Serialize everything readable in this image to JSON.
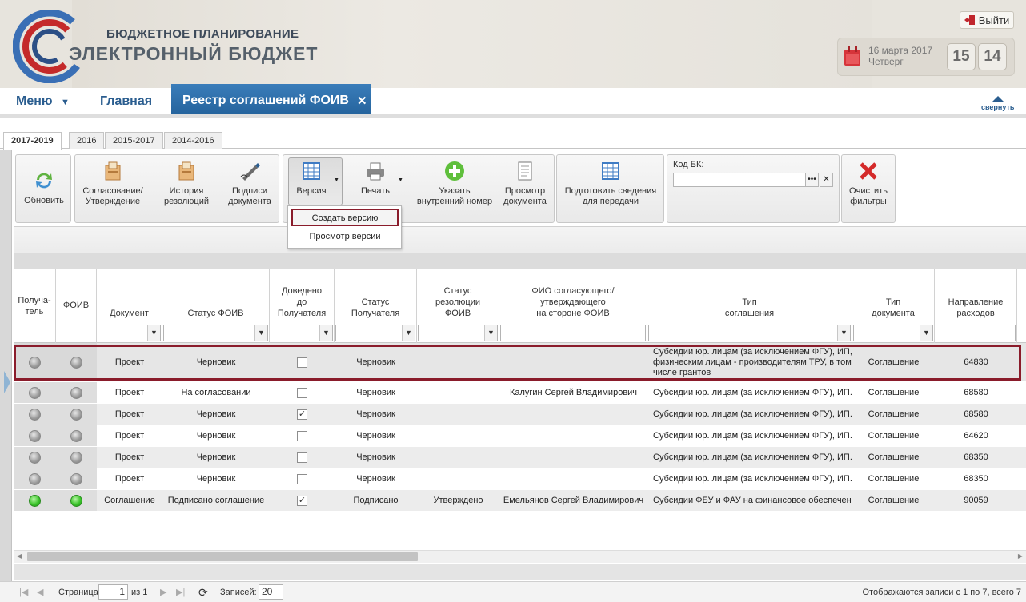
{
  "header": {
    "brand_line1": "БЮДЖЕТНОЕ ПЛАНИРОВАНИЕ",
    "brand_line2": "ЭЛЕКТРОННЫЙ БЮДЖЕТ",
    "exit_label": "Выйти",
    "date": "16 марта 2017",
    "weekday": "Четверг",
    "clock_hours": "15",
    "clock_minutes": "14"
  },
  "nav": {
    "menu_label": "Меню",
    "home_label": "Главная",
    "active_tab": "Реестр соглашений ФОИВ",
    "collapse_label": "свернуть"
  },
  "year_tabs": [
    "2017-2019",
    "2016",
    "2015-2017",
    "2014-2016"
  ],
  "toolbar": {
    "refresh": "Обновить",
    "approval": [
      "Согласование/",
      "Утверждение"
    ],
    "history": [
      "История",
      "резолюций"
    ],
    "signatures": [
      "Подписи",
      "документа"
    ],
    "version": "Версия",
    "print": "Печать",
    "internal_number": [
      "Указать",
      "внутренний номер"
    ],
    "view_document": [
      "Просмотр",
      "документа"
    ],
    "prepare_data": [
      "Подготовить сведения",
      "для передачи"
    ],
    "kbk_label": "Код БК:",
    "kbk_value": "",
    "clear_filters": [
      "Очистить",
      "фильтры"
    ]
  },
  "version_menu": {
    "create": "Создать версию",
    "view": "Просмотр версии"
  },
  "columns": [
    [
      "Получа-",
      "тель"
    ],
    [
      "ФОИВ"
    ],
    [
      "Документ"
    ],
    [
      "Статус ФОИВ"
    ],
    [
      "Доведено",
      "до",
      "Получателя"
    ],
    [
      "Статус",
      "Получателя"
    ],
    [
      "Статус",
      "резолюции",
      "ФОИВ"
    ],
    [
      "ФИО согласующего/",
      "утверждающего",
      "на стороне ФОИВ"
    ],
    [
      "Тип",
      "соглашения"
    ],
    [
      "Тип",
      "документа"
    ],
    [
      "Направление",
      "расходов"
    ]
  ],
  "rows": [
    {
      "recipient_lamp": "grey",
      "foiv_lamp": "grey",
      "document": "Проект",
      "foiv_status": "Черновик",
      "delivered": false,
      "recipient_status": "Черновик",
      "resolution_status": "",
      "approver": "",
      "agreement_type": "Субсидии юр. лицам (за исключением ФГУ), ИП, физическим лицам - производителям ТРУ, в том числе грантов",
      "doc_type": "Соглашение",
      "expense_direction": "64830"
    },
    {
      "recipient_lamp": "grey",
      "foiv_lamp": "grey",
      "document": "Проект",
      "foiv_status": "На согласовании",
      "delivered": false,
      "recipient_status": "Черновик",
      "resolution_status": "",
      "approver": "Калугин Сергей Владимирович",
      "agreement_type": "Субсидии юр. лицам (за исключением ФГУ), ИП...",
      "doc_type": "Соглашение",
      "expense_direction": "68580"
    },
    {
      "recipient_lamp": "grey",
      "foiv_lamp": "grey",
      "document": "Проект",
      "foiv_status": "Черновик",
      "delivered": true,
      "recipient_status": "Черновик",
      "resolution_status": "",
      "approver": "",
      "agreement_type": "Субсидии юр. лицам (за исключением ФГУ), ИП...",
      "doc_type": "Соглашение",
      "expense_direction": "68580"
    },
    {
      "recipient_lamp": "grey",
      "foiv_lamp": "grey",
      "document": "Проект",
      "foiv_status": "Черновик",
      "delivered": false,
      "recipient_status": "Черновик",
      "resolution_status": "",
      "approver": "",
      "agreement_type": "Субсидии юр. лицам (за исключением ФГУ), ИП...",
      "doc_type": "Соглашение",
      "expense_direction": "64620"
    },
    {
      "recipient_lamp": "grey",
      "foiv_lamp": "grey",
      "document": "Проект",
      "foiv_status": "Черновик",
      "delivered": false,
      "recipient_status": "Черновик",
      "resolution_status": "",
      "approver": "",
      "agreement_type": "Субсидии юр. лицам (за исключением ФГУ), ИП...",
      "doc_type": "Соглашение",
      "expense_direction": "68350"
    },
    {
      "recipient_lamp": "grey",
      "foiv_lamp": "grey",
      "document": "Проект",
      "foiv_status": "Черновик",
      "delivered": false,
      "recipient_status": "Черновик",
      "resolution_status": "",
      "approver": "",
      "agreement_type": "Субсидии юр. лицам (за исключением ФГУ), ИП...",
      "doc_type": "Соглашение",
      "expense_direction": "68350"
    },
    {
      "recipient_lamp": "green",
      "foiv_lamp": "green",
      "document": "Соглашение",
      "foiv_status": "Подписано соглашение",
      "delivered": true,
      "recipient_status": "Подписано",
      "resolution_status": "Утверждено",
      "approver": "Емельянов Сергей Владимирович",
      "agreement_type": "Субсидии ФБУ и ФАУ на финансовое обеспечен...",
      "doc_type": "Соглашение",
      "expense_direction": "90059"
    }
  ],
  "pager": {
    "page_label": "Страница",
    "page_value": "1",
    "of_label": "из 1",
    "records_label": "Записей:",
    "records_value": "20",
    "summary": "Отображаются записи с 1 по 7, всего 7"
  },
  "colors": {
    "brand_blue": "#2a5d8f",
    "active_tab": "#2e6fa8",
    "highlight": "#8a1c2b"
  }
}
